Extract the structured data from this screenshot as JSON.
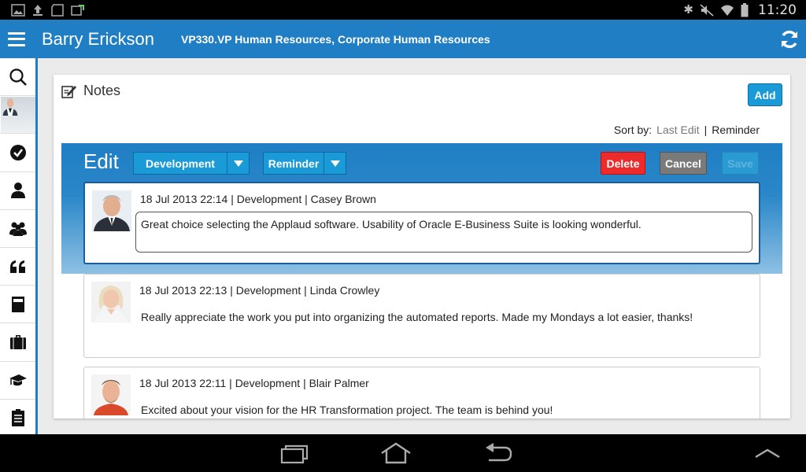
{
  "status_bar": {
    "time": "11:20"
  },
  "header": {
    "user_name": "Barry Erickson",
    "user_title": "VP330.VP Human Resources, Corporate Human Resources"
  },
  "sidebar": {
    "items": [
      {
        "icon": "search-icon"
      },
      {
        "icon": "avatar"
      },
      {
        "icon": "check-circle-icon"
      },
      {
        "icon": "person-icon"
      },
      {
        "icon": "group-icon"
      },
      {
        "icon": "quote-icon"
      },
      {
        "icon": "document-icon"
      },
      {
        "icon": "briefcase-icon"
      },
      {
        "icon": "graduation-cap-icon"
      },
      {
        "icon": "clipboard-list-icon"
      }
    ]
  },
  "panel": {
    "title": "Notes",
    "add_label": "Add",
    "sort_label": "Sort by:",
    "sort_options": [
      "Last Edit",
      "Reminder"
    ],
    "sort_separator": "|"
  },
  "edit": {
    "title": "Edit",
    "category_dropdown": "Development",
    "reminder_dropdown": "Reminder",
    "delete_label": "Delete",
    "cancel_label": "Cancel",
    "save_label": "Save"
  },
  "notes": [
    {
      "meta": "18 Jul 2013 22:14 | Development | Casey Brown",
      "text": "Great choice selecting the Applaud software. Usability of Oracle E-Business Suite is looking wonderful."
    },
    {
      "meta": "18 Jul 2013 22:13 | Development | Linda Crowley",
      "text": "Really appreciate the work you put into organizing the automated reports. Made my Mondays a lot easier, thanks!"
    },
    {
      "meta": "18 Jul 2013 22:11 | Development | Blair Palmer",
      "text": "Excited about your vision for the HR Transformation project. The team is behind you!"
    }
  ],
  "colors": {
    "brand_blue": "#1f7ec4",
    "button_blue": "#1a9ad6",
    "delete_red": "#ee2b2b",
    "cancel_gray": "#7a7a7a"
  }
}
